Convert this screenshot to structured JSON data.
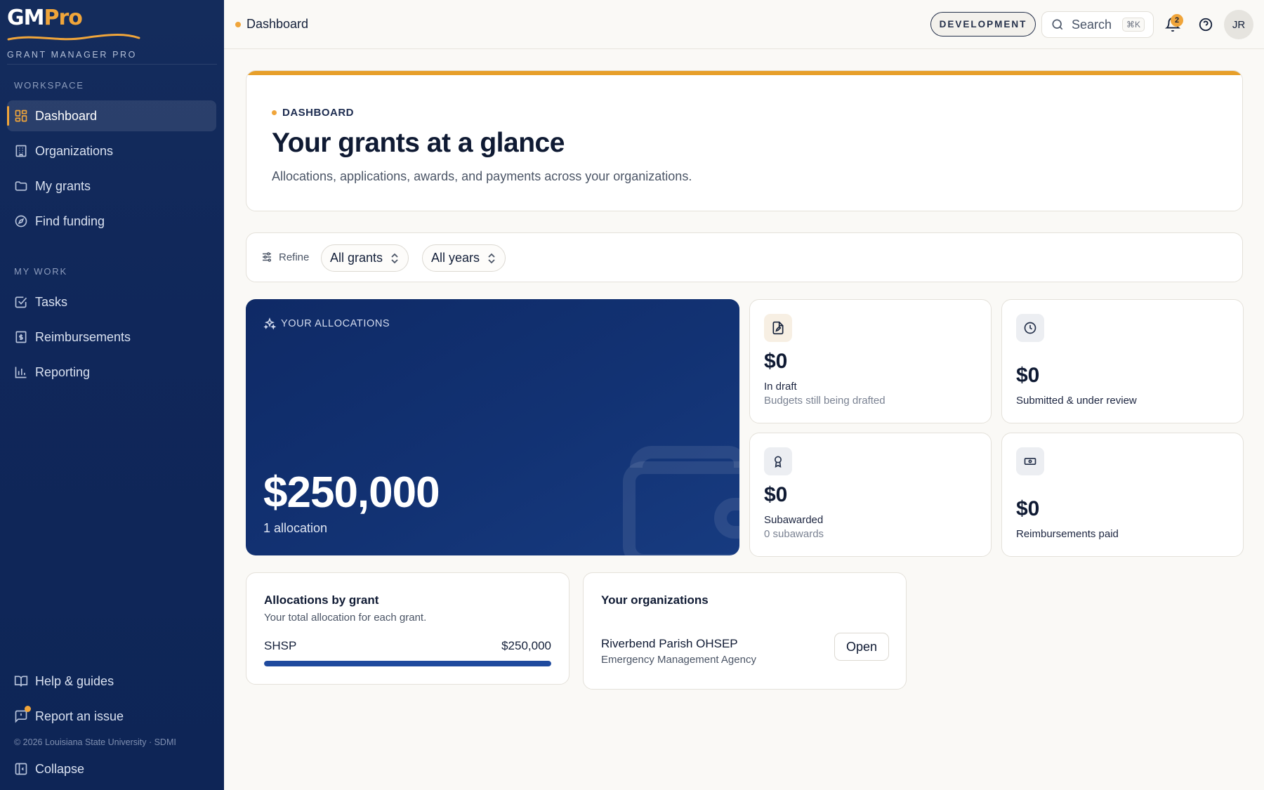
{
  "brand": {
    "logo_gm": "GM",
    "logo_pro": "Pro",
    "subtitle": "GRANT MANAGER PRO",
    "accent_color": "#f0a53a",
    "navy_color": "#10275a"
  },
  "sidebar": {
    "workspace_label": "WORKSPACE",
    "workspace_items": [
      {
        "label": "Dashboard",
        "icon": "dashboard-grid-icon",
        "active": true
      },
      {
        "label": "Organizations",
        "icon": "building-icon"
      },
      {
        "label": "My grants",
        "icon": "folder-icon"
      },
      {
        "label": "Find funding",
        "icon": "compass-icon"
      }
    ],
    "mywork_label": "MY WORK",
    "mywork_items": [
      {
        "label": "Tasks",
        "icon": "checkbox-icon"
      },
      {
        "label": "Reimbursements",
        "icon": "receipt-icon"
      },
      {
        "label": "Reporting",
        "icon": "bar-chart-icon"
      }
    ],
    "footer_items": [
      {
        "label": "Help & guides",
        "icon": "book-open-icon"
      },
      {
        "label": "Report an issue",
        "icon": "message-alert-icon"
      }
    ],
    "copyright": "© 2026 Louisiana State University · SDMI",
    "collapse_label": "Collapse"
  },
  "topbar": {
    "breadcrumb": "Dashboard",
    "environment": "DEVELOPMENT",
    "search_label": "Search",
    "search_shortcut": "⌘K",
    "notification_count": "2",
    "avatar_initials": "JR"
  },
  "hero": {
    "eyebrow": "DASHBOARD",
    "title": "Your grants at a glance",
    "subtitle": "Allocations, applications, awards, and payments across your organizations."
  },
  "filters": {
    "refine_label": "Refine",
    "grant_select": "All grants",
    "year_select": "All years"
  },
  "allocations": {
    "eyebrow": "YOUR ALLOCATIONS",
    "amount": "$250,000",
    "count": "1 allocation"
  },
  "stats": [
    {
      "value": "$0",
      "label": "In draft",
      "sub": "Budgets still being drafted",
      "icon": "file-pen-icon"
    },
    {
      "value": "$0",
      "label": "Submitted & under review",
      "sub": "",
      "icon": "clock-icon"
    },
    {
      "value": "$0",
      "label": "Subawarded",
      "sub": "0 subawards",
      "icon": "award-ribbon-icon"
    },
    {
      "value": "$0",
      "label": "Reimbursements paid",
      "sub": "",
      "icon": "banknote-icon"
    }
  ],
  "allocations_by_grant": {
    "title": "Allocations by grant",
    "subtitle": "Your total allocation for each grant.",
    "rows": [
      {
        "grant": "SHSP",
        "amount": "$250,000",
        "share": 1.0
      }
    ]
  },
  "organizations": {
    "title": "Your organizations",
    "items": [
      {
        "name": "Riverbend Parish OHSEP",
        "type": "Emergency Management Agency",
        "action": "Open"
      }
    ]
  }
}
